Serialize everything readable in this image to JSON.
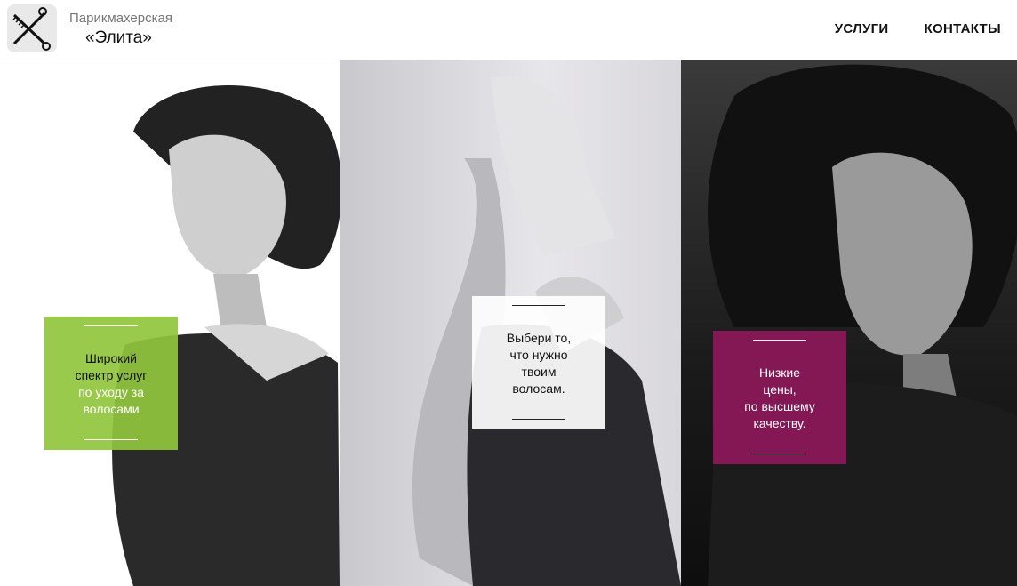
{
  "brand": {
    "subtitle": "Парикмахерская",
    "name": "«Элита»",
    "logo_icon": "comb-scissors-icon"
  },
  "nav": {
    "items": [
      {
        "label": "УСЛУГИ"
      },
      {
        "label": "КОНТАКТЫ"
      }
    ]
  },
  "panels": [
    {
      "card": {
        "lines": [
          "Широкий",
          "спектр услуг",
          "по уходу за",
          "волосами"
        ],
        "color": "#90c63c"
      }
    },
    {
      "card": {
        "lines": [
          "Выбери то,",
          "что нужно",
          "твоим",
          "волосам."
        ],
        "color": "#ffffff"
      }
    },
    {
      "card": {
        "lines": [
          "Низкие",
          "цены,",
          "по высшему",
          "качеству."
        ],
        "color": "#8c185a"
      }
    }
  ]
}
